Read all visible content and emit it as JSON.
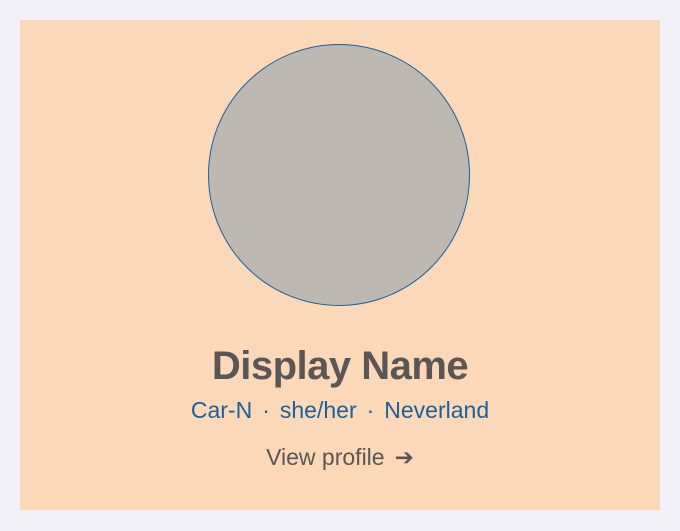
{
  "profile": {
    "display_name": "Display Name",
    "handle": "Car-N",
    "pronouns": "she/her",
    "location": "Neverland",
    "separator": "·",
    "view_profile_label": "View profile",
    "arrow_glyph": "➔"
  },
  "colors": {
    "page_background": "#f2f1f7",
    "card_background": "#fbd8b8",
    "avatar_fill": "#bdb8b2",
    "accent_blue": "#1f5f99",
    "text_gray": "#5b5654"
  },
  "icons": {
    "avatar": "avatar-placeholder",
    "arrow": "arrow-right-icon"
  }
}
